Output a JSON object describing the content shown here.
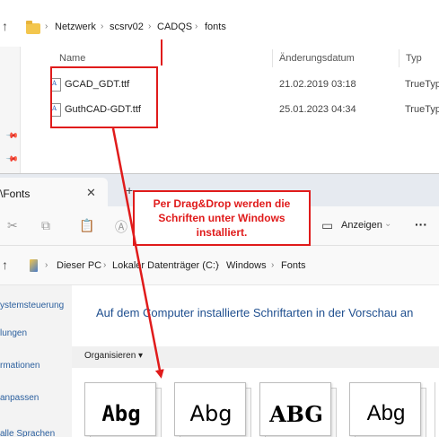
{
  "top_window": {
    "breadcrumbs": [
      "Netzwerk",
      "scsrv02",
      "CADQS",
      "fonts"
    ],
    "columns": {
      "name": "Name",
      "modified": "Änderungsdatum",
      "type": "Typ"
    },
    "files": [
      {
        "name": "GCAD_GDT.ttf",
        "modified": "21.02.2019 03:18",
        "type": "TrueType"
      },
      {
        "name": "GuthCAD-GDT.ttf",
        "modified": "25.01.2023 04:34",
        "type": "TrueType"
      }
    ]
  },
  "bottom_window": {
    "tab_title": "\\Fonts",
    "toolbar": {
      "view_label": "Anzeigen",
      "more_label": "···"
    },
    "breadcrumbs": [
      "Dieser PC",
      "Lokaler Datenträger (C:)",
      "Windows",
      "Fonts"
    ],
    "nav_items": [
      "ystemsteuerung",
      "lungen",
      "rmationen",
      "anpassen",
      "alle Sprachen"
    ],
    "content_title": "Auf dem Computer installierte Schriftarten in der Vorschau an",
    "organize_label": "Organisieren ▾",
    "font_samples": [
      "Abg",
      "Abg",
      "ABG",
      "Abg"
    ]
  },
  "annotation": {
    "text": "Per Drag&Drop werden die\nSchriften unter Windows\ninstalliert.",
    "color": "#e01b1b"
  }
}
